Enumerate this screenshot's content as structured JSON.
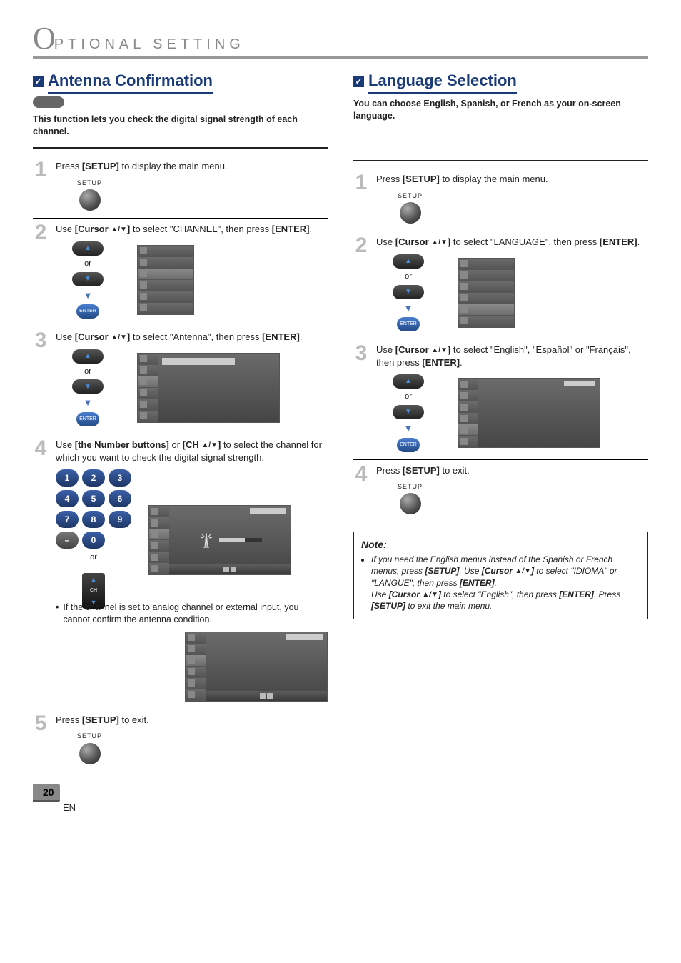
{
  "page": {
    "title_first": "O",
    "title_rest": "PTIONAL  SETTING",
    "number": "20",
    "en": "EN"
  },
  "left": {
    "check": "✓",
    "title": "Antenna Confirmation",
    "intro": "This function lets you check the digital signal strength of each channel.",
    "s1": {
      "num": "1",
      "before": "Press ",
      "b1": "[SETUP]",
      "after": " to display the main menu.",
      "setup": "SETUP"
    },
    "s2": {
      "num": "2",
      "before": "Use ",
      "b1": "[Cursor ",
      "arr": "▲/▼",
      "b1b": "]",
      "mid": " to select \"CHANNEL\", then press ",
      "b2": "[ENTER]",
      "after": ".",
      "or": "or",
      "enter": "ENTER"
    },
    "s3": {
      "num": "3",
      "before": "Use ",
      "b1": "[Cursor ",
      "arr": "▲/▼",
      "b1b": "]",
      "mid": " to select \"Antenna\", then press ",
      "b2": "[ENTER]",
      "after": ".",
      "or": "or",
      "enter": "ENTER"
    },
    "s4": {
      "num": "4",
      "before": "Use ",
      "b1": "[the Number buttons]",
      "mid": " or ",
      "b2": "[CH ",
      "arr": "▲/▼",
      "b2b": "]",
      "after": " to select the channel for which you want to check the digital signal strength.",
      "keys": {
        "1": "1",
        "2": "2",
        "3": "3",
        "4": "4",
        "5": "5",
        "6": "6",
        "7": "7",
        "8": "8",
        "9": "9",
        "0": "0",
        "dash": "–",
        "or": "or",
        "ch": "CH"
      },
      "bullet": "If the channel is set to analog channel or external input, you cannot confirm the antenna condition."
    },
    "s5": {
      "num": "5",
      "before": "Press ",
      "b1": "[SETUP]",
      "after": " to exit.",
      "setup": "SETUP"
    }
  },
  "right": {
    "check": "✓",
    "title": "Language Selection",
    "intro": "You can choose English, Spanish, or French as your on-screen language.",
    "s1": {
      "num": "1",
      "before": "Press ",
      "b1": "[SETUP]",
      "after": " to display the main menu.",
      "setup": "SETUP"
    },
    "s2": {
      "num": "2",
      "before": "Use ",
      "b1": "[Cursor ",
      "arr": "▲/▼",
      "b1b": "]",
      "mid": " to select \"LANGUAGE\", then press ",
      "b2": "[ENTER]",
      "after": ".",
      "or": "or",
      "enter": "ENTER"
    },
    "s3": {
      "num": "3",
      "before": "Use ",
      "b1": "[Cursor ",
      "arr": "▲/▼",
      "b1b": "]",
      "mid": " to select \"English\", \"Español\" or \"Français\", then press ",
      "b2": "[ENTER]",
      "after": ".",
      "or": "or",
      "enter": "ENTER"
    },
    "s4": {
      "num": "4",
      "before": "Press ",
      "b1": "[SETUP]",
      "after": " to exit.",
      "setup": "SETUP"
    },
    "note_head": "Note:",
    "note_body_a": "If you need the English menus instead of the Spanish or French menus, press ",
    "note_b1": "[SETUP]",
    "note_body_b": ". Use ",
    "note_b2": "[Cursor ",
    "note_arr": "▲/▼",
    "note_b2b": "]",
    "note_body_c": " to select \"IDIOMA\" or \"LANGUE\", then press ",
    "note_b3": "[ENTER]",
    "note_body_d": ".",
    "note_line2_a": "Use ",
    "note_l2_b1": "[Cursor ",
    "note_l2_arr": "▲/▼",
    "note_l2_b1b": "]",
    "note_line2_b": " to select \"English\", then press ",
    "note_l2_b2": "[ENTER]",
    "note_line2_c": ". Press ",
    "note_l2_b3": "[SETUP]",
    "note_line2_d": " to exit the main menu."
  }
}
